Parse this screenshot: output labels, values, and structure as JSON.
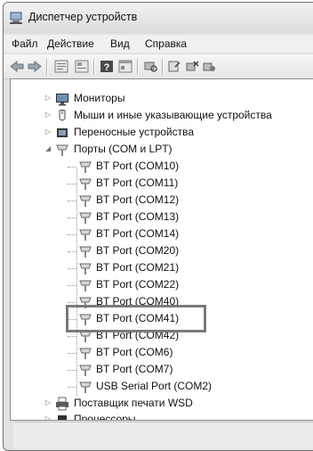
{
  "window": {
    "title": "Диспетчер устройств"
  },
  "menu": {
    "items": [
      "Файл",
      "Действие",
      "Вид",
      "Справка"
    ]
  },
  "toolbar": {
    "buttons": [
      "back-icon",
      "forward-icon",
      "properties-icon",
      "show-hidden-icon",
      "help-icon",
      "view-icon",
      "scan-icon",
      "update-driver-icon",
      "uninstall-icon",
      "disable-icon"
    ]
  },
  "tree": {
    "monitors": "Мониторы",
    "mice": "Мыши и иные указывающие устройства",
    "portable": "Переносные устройства",
    "ports": "Порты (COM и LPT)",
    "port_items": [
      "BT Port (COM10)",
      "BT Port (COM11)",
      "BT Port (COM12)",
      "BT Port (COM13)",
      "BT Port (COM14)",
      "BT Port (COM20)",
      "BT Port (COM21)",
      "BT Port (COM22)",
      "BT Port (COM40)",
      "BT Port (COM41)",
      "BT Port (COM42)",
      "BT Port (COM6)",
      "BT Port (COM7)",
      "USB Serial Port (COM2)"
    ],
    "print_providers": "Поставщик печати WSD",
    "processors": "Процессоры"
  },
  "highlighted_item": "BT Port (COM41)"
}
